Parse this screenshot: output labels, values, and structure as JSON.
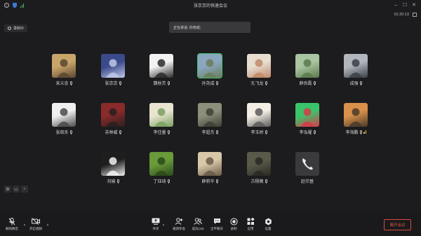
{
  "window": {
    "title": "张京京的快速会议",
    "timer": "01:20:13"
  },
  "recording_label": "录制中",
  "speaking_label": "正在讲话: 孙尧成;",
  "participants": [
    {
      "name": "宋义忠",
      "mic": true,
      "colors": [
        "#c8a56a",
        "#5a4630"
      ]
    },
    {
      "name": "张京京",
      "mic": true,
      "colors": [
        "#3a4a8a",
        "#c0c8e8"
      ]
    },
    {
      "name": "魏秋芳",
      "mic": true,
      "colors": [
        "#f2f2f2",
        "#2a2a2a"
      ]
    },
    {
      "name": "孙尧成",
      "mic": true,
      "active": true,
      "colors": [
        "#8aa7c0",
        "#6b7d5a"
      ]
    },
    {
      "name": "孔飞龙",
      "mic": true,
      "colors": [
        "#e7ded0",
        "#c08a6a"
      ]
    },
    {
      "name": "薛良磊",
      "mic": true,
      "colors": [
        "#a8c4a0",
        "#5d7a4e"
      ]
    },
    {
      "name": "成强",
      "mic": true,
      "colors": [
        "#b0b6bc",
        "#3a3f45"
      ]
    },
    {
      "name": "张晓东",
      "mic": true,
      "colors": [
        "#f0f0f0",
        "#4a4a4a"
      ]
    },
    {
      "name": "苏林威",
      "mic": true,
      "colors": [
        "#8a2a2a",
        "#2a1f1f"
      ]
    },
    {
      "name": "李佳量",
      "mic": true,
      "colors": [
        "#e8e4d0",
        "#7aa060"
      ]
    },
    {
      "name": "李超杰",
      "mic": true,
      "colors": [
        "#8c8f7a",
        "#3d3f35"
      ]
    },
    {
      "name": "李玉娇",
      "mic": true,
      "colors": [
        "#f4eee4",
        "#5a5a5a"
      ]
    },
    {
      "name": "李泓擢",
      "mic": true,
      "colors": [
        "#3ac46a",
        "#d83a4a"
      ]
    },
    {
      "name": "李海鹏",
      "mic": true,
      "signal": true,
      "colors": [
        "#d8904a",
        "#4a3a2a"
      ]
    },
    {
      "name": "刘瑜",
      "mic": true,
      "colors": [
        "#1e1e1e",
        "#f2f2f2"
      ]
    },
    {
      "name": "丁钰琦",
      "mic": true,
      "colors": [
        "#6a9a3a",
        "#2a4a1a"
      ]
    },
    {
      "name": "薛莉华",
      "mic": true,
      "colors": [
        "#d8c8a8",
        "#6a5a4a"
      ]
    },
    {
      "name": "古栩薇",
      "mic": true,
      "colors": [
        "#5a5a4a",
        "#2a2a24"
      ]
    },
    {
      "name": "赵宗基",
      "mic": false,
      "phone": true,
      "colors": [
        "#3a3a3c",
        "#3a3a3c"
      ]
    }
  ],
  "toolbar": {
    "mute_label": "解除静音",
    "video_label": "开启视频",
    "share_label": "共享",
    "invite_label": "邀请参会",
    "members_label": "成员(19)",
    "chat_label": "全平聊天",
    "record_label": "录制",
    "apps_label": "应用",
    "settings_label": "设置",
    "leave_label": "离开会议"
  }
}
